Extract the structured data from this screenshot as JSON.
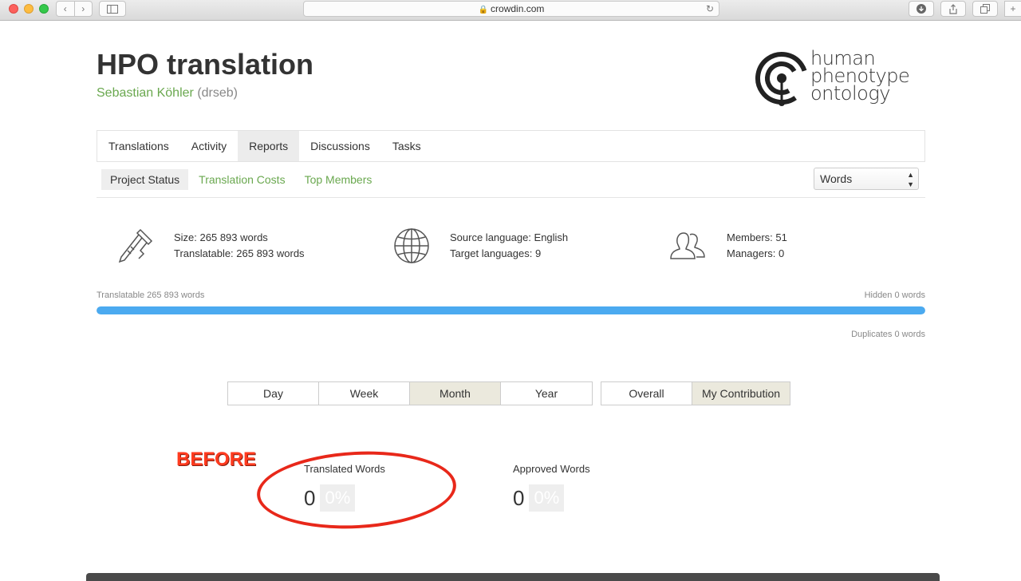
{
  "browser": {
    "url": "crowdin.com"
  },
  "project": {
    "title": "HPO translation",
    "owner_name": "Sebastian Köhler",
    "owner_handle": "(drseb)"
  },
  "logo": {
    "line1": "human",
    "line2": "phenotype",
    "line3": "ontology"
  },
  "tabs": [
    {
      "label": "Translations"
    },
    {
      "label": "Activity"
    },
    {
      "label": "Reports",
      "active": true
    },
    {
      "label": "Discussions"
    },
    {
      "label": "Tasks"
    }
  ],
  "subtabs": [
    {
      "label": "Project Status",
      "active": true
    },
    {
      "label": "Translation Costs"
    },
    {
      "label": "Top Members"
    }
  ],
  "unit_select": {
    "value": "Words"
  },
  "stats": {
    "size": "Size: 265 893 words",
    "translatable": "Translatable: 265 893 words",
    "source_language": "Source language: English",
    "target_languages": "Target languages: 9",
    "members": "Members: 51",
    "managers": "Managers: 0"
  },
  "progress": {
    "left_label": "Translatable 265 893 words",
    "right_label": "Hidden 0 words",
    "duplicates_label": "Duplicates 0 words",
    "fill_fraction": 1.0,
    "color": "#4baaf0"
  },
  "period_buttons": [
    {
      "label": "Day"
    },
    {
      "label": "Week"
    },
    {
      "label": "Month",
      "active": true
    },
    {
      "label": "Year"
    }
  ],
  "scope_buttons": [
    {
      "label": "Overall"
    },
    {
      "label": "My Contribution",
      "active": true
    }
  ],
  "translated": {
    "label": "Translated Words",
    "count": "0",
    "percent": "0%"
  },
  "approved": {
    "label": "Approved Words",
    "count": "0",
    "percent": "0%"
  },
  "annotation": {
    "text": "BEFORE",
    "color": "#ff3b1f"
  },
  "colors": {
    "accent_green": "#6aa84f",
    "progress_blue": "#4baaf0"
  }
}
